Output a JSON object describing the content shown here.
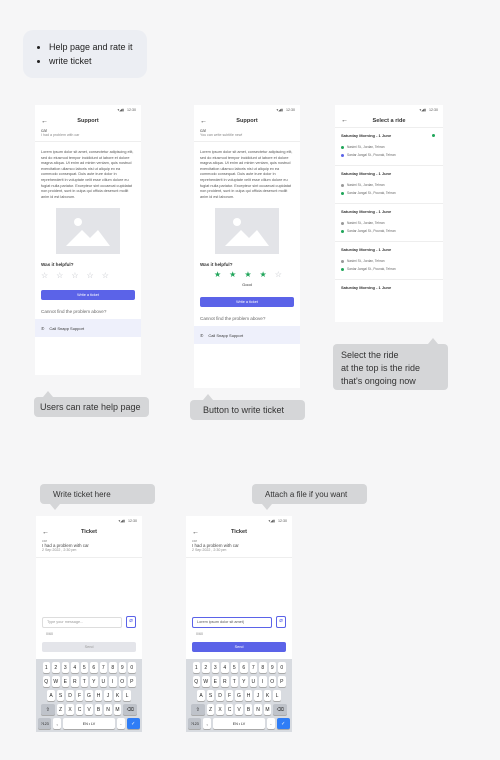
{
  "note": {
    "items": [
      "Help page and rate it",
      "write ticket"
    ]
  },
  "status_time": "12:30",
  "screen1": {
    "title": "Support",
    "topic": "car",
    "subtitle": "I had a problem with car",
    "lorem": "Lorem ipsum dolor sit amet, consectetur adipiscing elit, sed do eiusmod tempor incididunt ut labore et dolore magna aliqua. Ut enim ad minim veniam, quis nostrud exercitation ullamco laboris nisi ut aliquip ex ea commodo consequat. Duis aute irure dolor in reprehenderit in voluptate velit esse cillum dolore eu fugiat nulla pariatur. Excepteur sint occaecat cupidatat non proident, sunt in culpa qui officia deserunt mollit anim id est laborum.",
    "helpful": "Was it helpful?",
    "rating": 0,
    "write_btn": "Write a ticket",
    "cant_find": "Cannot find the problem above?",
    "call": "Call Snapp Support"
  },
  "screen2": {
    "title": "Support",
    "topic": "car",
    "subtitle": "You can write subtitle new!",
    "lorem": "Lorem ipsum dolor sit amet, consectetur adipiscing elit, sed do eiusmod tempor incididunt ut labore et dolore magna aliqua. Ut enim ad minim veniam, quis nostrud exercitation ullamco laboris nisi ut aliquip ex ea commodo consequat. Duis aute irure dolor in reprehenderit in voluptate velit esse cillum dolore eu fugiat nulla pariatur. Excepteur sint occaecat cupidatat non proident, sunt in culpa qui officia deserunt mollit anim id est laborum.",
    "helpful": "Was it helpful?",
    "rating": 4,
    "rating_label": "Good",
    "write_btn": "Write a ticket",
    "cant_find": "Cannot find the problem above?",
    "call": "Call Snapp Support"
  },
  "screen3": {
    "title": "Select a ride",
    "rides": [
      {
        "title": "Saturday Morning - 1 June",
        "from": "Nasimi St., Jordan, Tehran",
        "to": "Sardar Jangal St., Pounak, Tehran",
        "selected": true
      },
      {
        "title": "Saturday Morning - 1 June",
        "from": "Nasimi St., Jordan, Tehran",
        "to": "Sardar Jangal St., Pounak, Tehran",
        "selected": false
      },
      {
        "title": "Saturday Morning - 1 June",
        "from": "Nasimi St., Jordan, Tehran",
        "to": "Sardar Jangal St., Pounak, Tehran",
        "selected": false
      },
      {
        "title": "Saturday Morning - 1 June",
        "from": "Nasimi St., Jordan, Tehran",
        "to": "Sardar Jangal St., Pounak, Tehran",
        "selected": false
      },
      {
        "title": "Saturday Morning - 1 June",
        "from": "",
        "to": "",
        "selected": false
      }
    ]
  },
  "callouts": {
    "rate": "Users can rate help page",
    "write": "Button to write ticket",
    "select": "Select the ride\nat the top is the ride\nthat's ongoing now",
    "ticket_here": "Write ticket here",
    "attach": "Attach a file if you want"
  },
  "ticket1": {
    "title": "Ticket",
    "topic": "car",
    "subject": "I had a problem with car",
    "date": "2 Sep 2022 , 2:30 pm",
    "placeholder": "Type your message...",
    "counter": "0/60",
    "send": "Send"
  },
  "ticket2": {
    "title": "Ticket",
    "topic": "car",
    "subject": "I had a problem with car",
    "date": "2 Sep 2022 , 2:30 pm",
    "value": "Lorem ipsum dolor sit amet|",
    "counter": "0/60",
    "send": "Send"
  },
  "keyboard": {
    "row1": [
      "1",
      "2",
      "3",
      "4",
      "5",
      "6",
      "7",
      "8",
      "9",
      "0"
    ],
    "row2": [
      "Q",
      "W",
      "E",
      "R",
      "T",
      "Y",
      "U",
      "I",
      "O",
      "P"
    ],
    "row3": [
      "A",
      "S",
      "D",
      "F",
      "G",
      "H",
      "J",
      "K",
      "L"
    ],
    "row4": [
      "Z",
      "X",
      "C",
      "V",
      "B",
      "N",
      "M"
    ],
    "mode": "?123",
    "comma": ",",
    "space": "EN • LV",
    "period": "."
  },
  "colors": {
    "primary": "#5b63e8",
    "star_on": "#20a55a",
    "callout": "#d5d6d8"
  }
}
